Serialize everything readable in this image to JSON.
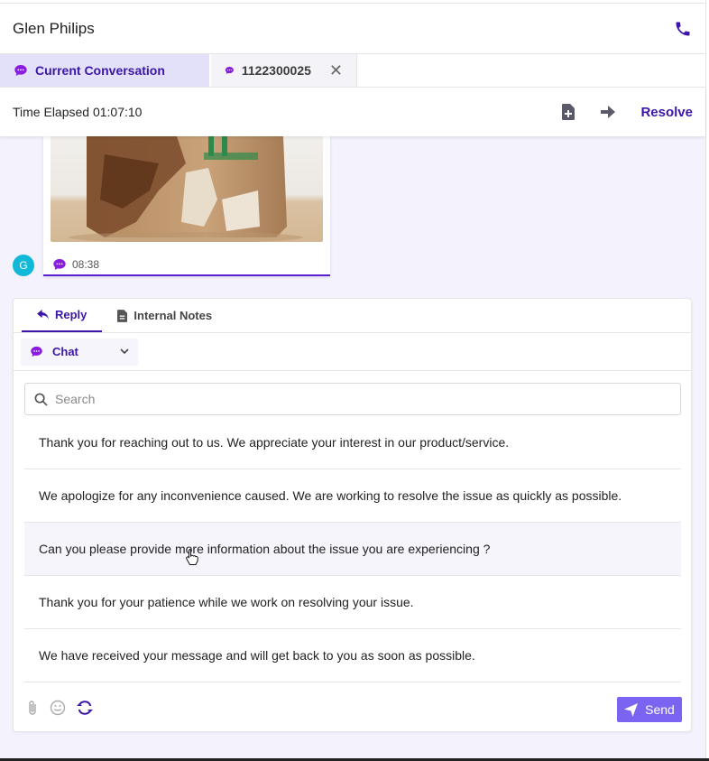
{
  "header": {
    "contact_name": "Glen Philips",
    "call_icon": "phone-icon"
  },
  "tabs": [
    {
      "label": "Current Conversation",
      "icon": "chat-bubble-icon",
      "active": true
    },
    {
      "label": "1122300025",
      "icon": "chat-bubble-icon",
      "closable": true
    }
  ],
  "timebar": {
    "elapsed": "Time Elapsed 01:07:10",
    "icons": [
      "add-note-icon",
      "forward-arrow-icon"
    ],
    "resolve_label": "Resolve"
  },
  "message": {
    "time": "08:38",
    "avatar_letter": "G",
    "image": "damaged-cardboard-box-photo"
  },
  "composer": {
    "tabs": [
      {
        "label": "Reply",
        "icon": "reply-icon",
        "active": true
      },
      {
        "label": "Internal Notes",
        "icon": "document-icon"
      }
    ],
    "channel": "Chat",
    "search_placeholder": "Search",
    "canned_replies": [
      "Thank you for reaching out to us. We appreciate your interest in our product/service.",
      "We apologize for any inconvenience caused. We are working to resolve the issue as quickly as possible.",
      "Can you please provide more information about the issue you are experiencing ?",
      "Thank you for your patience while we work on resolving your issue.",
      "We have received your message and will get back to you as soon as possible."
    ],
    "toolbar_icons": [
      "attachment-icon",
      "emoji-icon",
      "canned-response-icon"
    ],
    "send_label": "Send"
  },
  "colors": {
    "accent": "#3b16a8",
    "active_tab_bg": "#e3e0fa",
    "send_button": "#7c64f2",
    "avatar": "#11b8d8",
    "chat_icon": "#8a1be0"
  }
}
